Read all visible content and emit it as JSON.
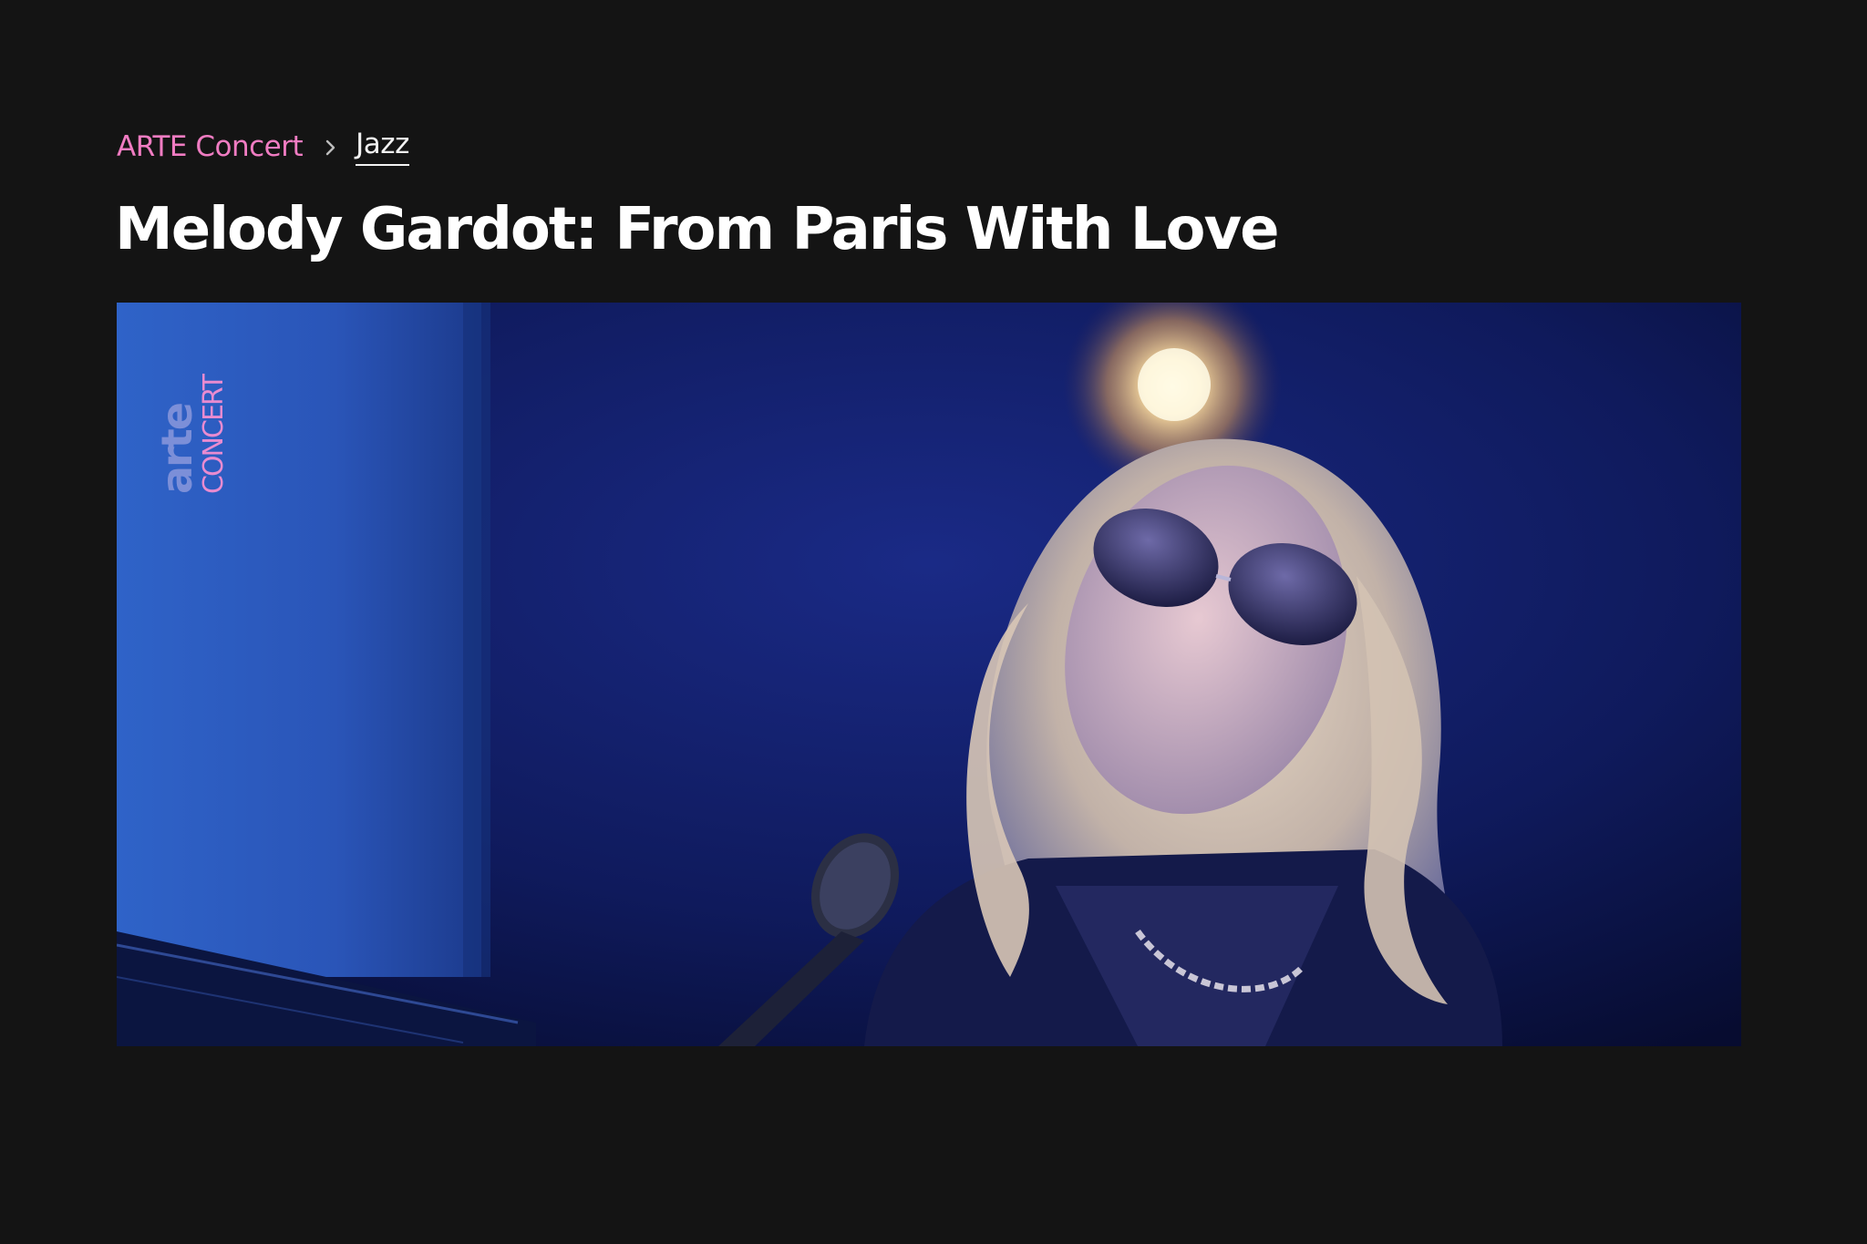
{
  "breadcrumb": {
    "root_label": "ARTE Concert",
    "separator_icon": "chevron-right-icon",
    "current_label": "Jazz"
  },
  "page": {
    "title": "Melody Gardot: From Paris With Love"
  },
  "video": {
    "logo": {
      "brand": "arte",
      "sub": "CONCERT"
    }
  },
  "colors": {
    "background": "#141414",
    "breadcrumb_accent": "#f07cc2",
    "title": "#ffffff",
    "logo_arte": "#7c8fd8",
    "logo_concert": "#e98bd0"
  }
}
